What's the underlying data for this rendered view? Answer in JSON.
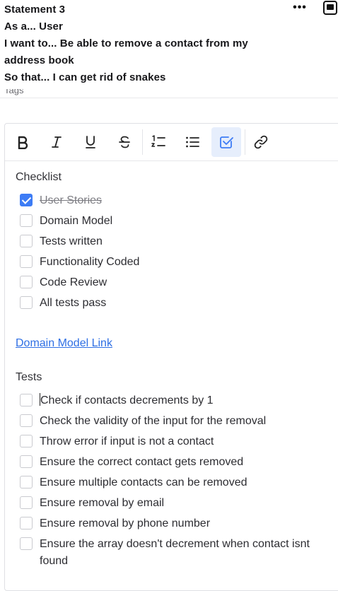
{
  "header": {
    "lines": [
      "Statement 3",
      "As a... User",
      "I want to... Be able to remove a contact from my",
      "address book",
      "So that... I can get rid of snakes"
    ],
    "more_label": "•••",
    "tags_label": "Tags"
  },
  "toolbar": {
    "buttons": [
      "bold-icon",
      "italic-icon",
      "underline-icon",
      "strikethrough-icon",
      "ordered-list-icon",
      "bullet-list-icon",
      "checklist-icon",
      "link-icon"
    ],
    "accent": "#3d7cf5"
  },
  "checklist": {
    "title": "Checklist",
    "items": [
      {
        "label": "User Stories",
        "checked": true
      },
      {
        "label": "Domain Model",
        "checked": false
      },
      {
        "label": "Tests written",
        "checked": false
      },
      {
        "label": "Functionality Coded",
        "checked": false
      },
      {
        "label": "Code Review",
        "checked": false
      },
      {
        "label": "All tests pass",
        "checked": false
      }
    ]
  },
  "link": {
    "label": "Domain Model Link",
    "color": "#2f6fe4"
  },
  "tests": {
    "title": "Tests",
    "items": [
      {
        "label": "Check if contacts decrements by 1",
        "checked": false
      },
      {
        "label": "Check the validity of the input for the removal",
        "checked": false
      },
      {
        "label": "Throw error if input is not a contact",
        "checked": false
      },
      {
        "label": "Ensure the correct contact gets removed",
        "checked": false
      },
      {
        "label": "Ensure multiple contacts can be removed",
        "checked": false
      },
      {
        "label": "Ensure removal by email",
        "checked": false
      },
      {
        "label": "Ensure removal by phone number",
        "checked": false
      },
      {
        "label": "Ensure the array doesn't decrement when contact isnt found",
        "checked": false
      }
    ]
  }
}
